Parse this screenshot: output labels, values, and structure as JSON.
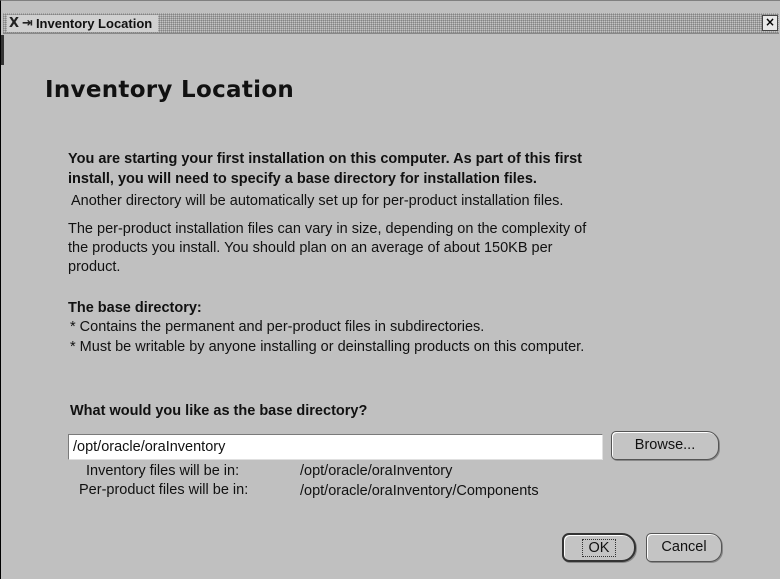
{
  "window": {
    "title": "Inventory Location",
    "x_logo": "X",
    "close_glyph": "×"
  },
  "heading": "Inventory Location",
  "intro": {
    "bold_line1": "You are starting your first installation on this computer. As part of this first",
    "bold_line2": "install, you will need to specify a base directory for installation files.",
    "line3": "Another directory will be automatically set up for per-product installation files.",
    "para2_line1": "The per-product installation files can vary in size, depending on the complexity of",
    "para2_line2": "the products you install.  You should plan on an average of about 150KB per",
    "para2_line3": "product."
  },
  "base_dir": {
    "heading": "The base directory:",
    "bullet1": "* Contains the permanent and per-product files in subdirectories.",
    "bullet2": "* Must be writable by anyone installing or deinstalling products on this computer."
  },
  "question": "What would you like as the base directory?",
  "path_input": {
    "value": "/opt/oracle/oraInventory"
  },
  "browse_label": "Browse...",
  "info": {
    "inventory_label": "Inventory files will be in:",
    "inventory_value": "/opt/oracle/oraInventory",
    "perproduct_label": "Per-product files will be in:",
    "perproduct_value": "/opt/oracle/oraInventory/Components"
  },
  "buttons": {
    "ok": "OK",
    "cancel": "Cancel"
  }
}
